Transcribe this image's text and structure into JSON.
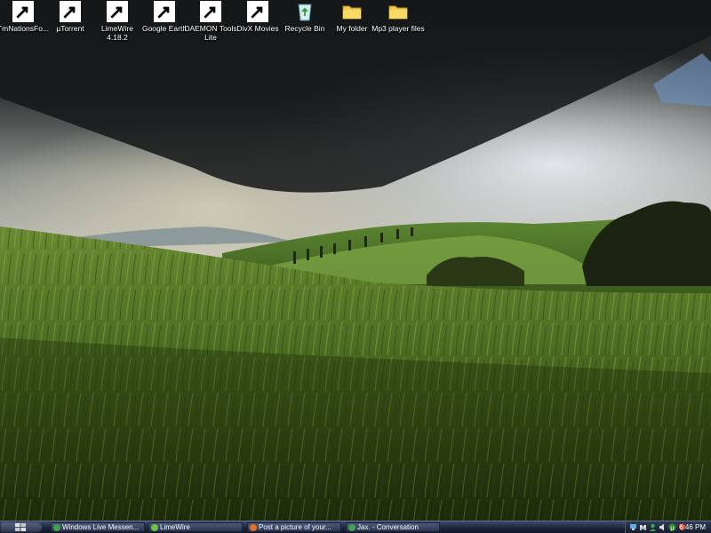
{
  "desktop": {
    "icons": [
      {
        "label": "TmNationsFo...",
        "icon": "tmnations-icon"
      },
      {
        "label": "µTorrent",
        "icon": "utorrent-icon"
      },
      {
        "label": "LimeWire 4.18.2",
        "icon": "limewire-icon"
      },
      {
        "label": "Google Earth",
        "icon": "google-earth-icon"
      },
      {
        "label": "DAEMON Tools Lite",
        "icon": "daemon-tools-icon"
      },
      {
        "label": "DivX Movies",
        "icon": "divx-icon"
      },
      {
        "label": "Recycle Bin",
        "icon": "recycle-bin-icon"
      },
      {
        "label": "My folder",
        "icon": "folder-icon"
      },
      {
        "label": "Mp3 player files",
        "icon": "folder-icon"
      }
    ]
  },
  "taskbar": {
    "tasks": [
      {
        "label": "Windows Live Messen...",
        "icon": "messenger-icon",
        "color": "#3fa34d"
      },
      {
        "label": "LimeWire",
        "icon": "limewire-icon",
        "color": "#6cc04a"
      },
      {
        "label": "Post a picture of your...",
        "icon": "firefox-icon",
        "color": "#e0702a"
      },
      {
        "label": "Jax. - Conversation",
        "icon": "messenger-icon",
        "color": "#3fa34d"
      }
    ],
    "tray": {
      "icons": [
        "network-icon",
        "mcafee-icon",
        "messenger-icon",
        "volume-icon",
        "utorrent-icon",
        "shield-icon"
      ],
      "clock": "6:46 PM"
    }
  }
}
